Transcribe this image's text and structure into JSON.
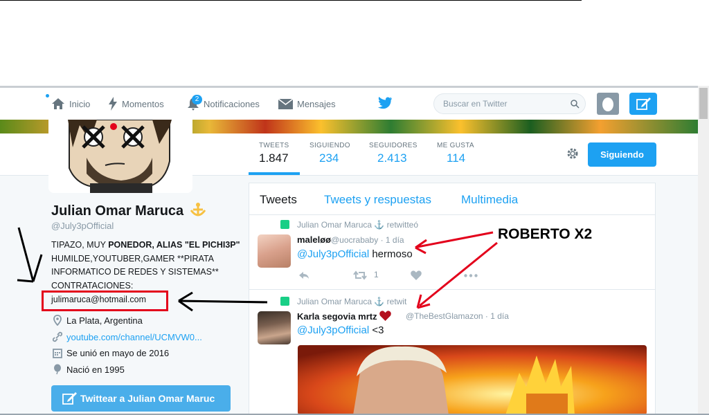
{
  "nav": {
    "home": "Inicio",
    "moments": "Momentos",
    "notifications": "Notificaciones",
    "notifications_count": "2",
    "messages": "Mensajes",
    "search_placeholder": "Buscar en Twitter"
  },
  "stats": [
    {
      "label": "TWEETS",
      "value": "1.847"
    },
    {
      "label": "SIGUIENDO",
      "value": "234"
    },
    {
      "label": "SEGUIDORES",
      "value": "2.413"
    },
    {
      "label": "ME GUSTA",
      "value": "114"
    }
  ],
  "follow_button": "Siguiendo",
  "profile": {
    "name": "Julian Omar Maruca",
    "handle": "@July3pOfficial",
    "bio_line1_a": "TIPAZO, MUY ",
    "bio_line1_b": "PONEDOR, ALIAS \"EL PICHI3P\"",
    "bio_rest": "HUMILDE,YOUTUBER,GAMER **PIRATA INFORMATICO DE REDES Y SISTEMAS** CONTRATACIONES:",
    "email": "julimaruca@hotmail.com",
    "location": "La Plata, Argentina",
    "website": "youtube.com/channel/UCMVW0...",
    "joined": "Se unió en mayo de 2016",
    "born": "Nació en 1995",
    "tweet_to_button": "Twittear a Julian Omar Maruc"
  },
  "timeline_tabs": [
    "Tweets",
    "Tweets y respuestas",
    "Multimedia"
  ],
  "tweets": [
    {
      "retweeter": "Julian Omar Maruca",
      "retweet_text": "retwitteó",
      "author": "maleløø",
      "handle": "@uocrababy",
      "time": "· 1 día",
      "mention": "@July3pOfficial",
      "text": " hermoso",
      "retweets": "1"
    },
    {
      "retweeter": "Julian Omar Maruca",
      "retweet_text": "retwit",
      "author": "Karla segovia mrtz",
      "handle": "@TheBestGlamazon",
      "time": "· 1 día",
      "mention": "@July3pOfficial",
      "text": " <3"
    }
  ],
  "annotation": "ROBERTO X2",
  "colors": {
    "accent": "#1da1f2",
    "annotation_red": "#e3001b"
  }
}
